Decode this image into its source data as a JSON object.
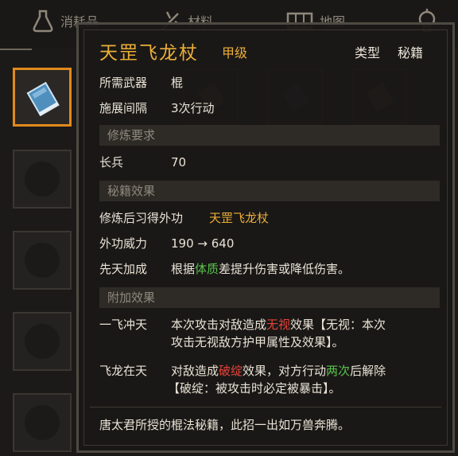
{
  "tabs": [
    {
      "label": "消耗品",
      "icon": "flask-icon"
    },
    {
      "label": "材料",
      "icon": "material-icon"
    },
    {
      "label": "地图",
      "icon": "map-icon"
    },
    {
      "label": "",
      "icon": "lamp-icon"
    }
  ],
  "item": {
    "name": "天罡飞龙杖",
    "grade": "甲级",
    "type_label": "类型",
    "type_value": "秘籍",
    "weapon_label": "所需武器",
    "weapon_value": "棍",
    "interval_label": "施展间隔",
    "interval_value": "3次行动",
    "req_section": "修炼要求",
    "req_name": "长兵",
    "req_value": "70",
    "effect_section": "秘籍效果",
    "learn_label": "修炼后习得外功",
    "learn_value": "天罡飞龙杖",
    "power_label": "外功威力",
    "power_value": "190 → 640",
    "innate_label": "先天加成",
    "innate_pre": "根据",
    "innate_attr": "体质",
    "innate_post": "差提升伤害或降低伤害。",
    "extra_section": "附加效果",
    "skill1_name": "一飞冲天",
    "skill1_pre": "本次攻击对敌造成",
    "skill1_kw": "无视",
    "skill1_post": "效果【无视：本次",
    "skill1_line2": "攻击无视敌方护甲属性及效果】。",
    "skill2_name": "飞龙在天",
    "skill2_pre": "对敌造成",
    "skill2_kw": "破绽",
    "skill2_mid": "效果，对方行动",
    "skill2_kw2": "两次",
    "skill2_post": "后解除",
    "skill2_line2": "【破绽：被攻击时必定被暴击】。",
    "description": "唐太君所授的棍法秘籍，此招一出如万兽奔腾。"
  },
  "colors": {
    "gold": "#ebae38",
    "green": "#59c24e",
    "red": "#e5433a",
    "selected_border": "#e08a1c"
  }
}
